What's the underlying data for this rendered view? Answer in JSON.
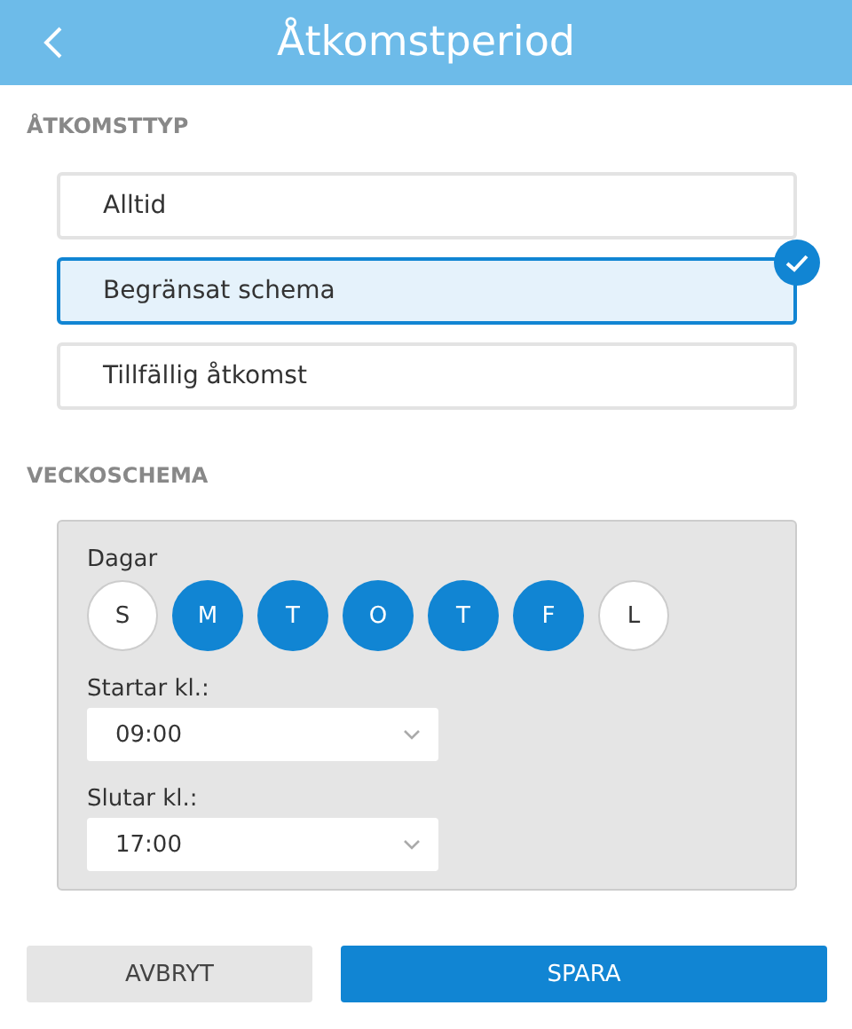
{
  "header": {
    "title": "Åtkomstperiod"
  },
  "access_type": {
    "label": "ÅTKOMSTTYP",
    "options": [
      {
        "label": "Alltid",
        "selected": false
      },
      {
        "label": "Begränsat schema",
        "selected": true
      },
      {
        "label": "Tillfällig åtkomst",
        "selected": false
      }
    ]
  },
  "weekly_schedule": {
    "label": "VECKOSCHEMA",
    "days_label": "Dagar",
    "days": [
      {
        "label": "S",
        "selected": false
      },
      {
        "label": "M",
        "selected": true
      },
      {
        "label": "T",
        "selected": true
      },
      {
        "label": "O",
        "selected": true
      },
      {
        "label": "T",
        "selected": true
      },
      {
        "label": "F",
        "selected": true
      },
      {
        "label": "L",
        "selected": false
      }
    ],
    "start": {
      "label": "Startar kl.:",
      "value": "09:00"
    },
    "end": {
      "label": "Slutar kl.:",
      "value": "17:00"
    }
  },
  "buttons": [
    {
      "label": "AVBRYT",
      "kind": "secondary"
    },
    {
      "label": "SPARA",
      "kind": "primary"
    }
  ]
}
